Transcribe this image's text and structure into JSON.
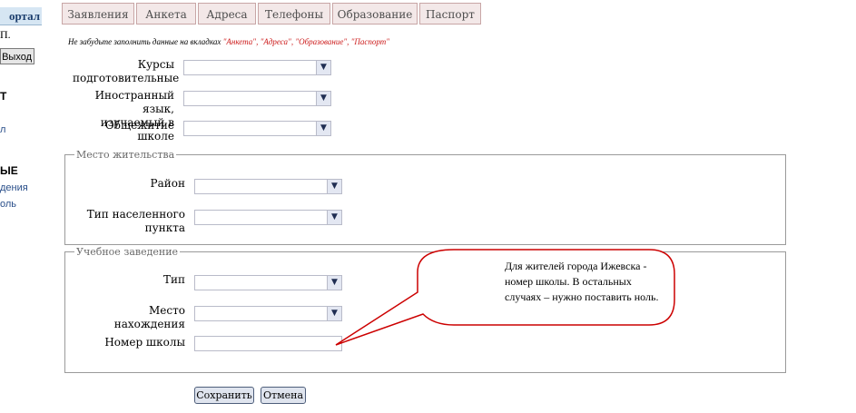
{
  "sidebar": {
    "header": "ортал",
    "user": "П.",
    "exit_button": "Выход",
    "bold1": "Т",
    "frag1": "л",
    "bold2": "ЫЕ",
    "link1": "дения",
    "link2": "оль"
  },
  "tabs": [
    {
      "label": "Заявления"
    },
    {
      "label": "Анкета"
    },
    {
      "label": "Адреса"
    },
    {
      "label": "Телефоны"
    },
    {
      "label": "Образование"
    },
    {
      "label": "Паспорт"
    }
  ],
  "notice": {
    "prefix": "Не забудьте заполнить данные на вкладках ",
    "tabs_list": "\"Анкета\", \"Адреса\", \"Образование\", \"Паспорт\""
  },
  "form": {
    "courses_label_line1": "Курсы",
    "courses_label_line2": "подготовительные",
    "language_label_line1": "Иностранный язык,",
    "language_label_line2": "изучаемый в школе",
    "dormitory_label": "Общежитие"
  },
  "residence": {
    "legend": "Место жительства",
    "district_label": "Район",
    "settlement_type_label_line1": "Тип населенного",
    "settlement_type_label_line2": "пункта"
  },
  "school": {
    "legend": "Учебное заведение",
    "type_label": "Тип",
    "location_label": "Место нахождения",
    "number_label": "Номер школы"
  },
  "buttons": {
    "save": "Сохранить",
    "cancel": "Отмена"
  },
  "callout": {
    "line1": "Для жителей города Ижевска  -",
    "line2": "номер школы. В остальных",
    "line3": "случаях – нужно поставить ноль."
  },
  "colors": {
    "callout_stroke": "#cc0000",
    "tab_bg": "#f3e8e8",
    "notice_red": "#cc1b1b"
  }
}
